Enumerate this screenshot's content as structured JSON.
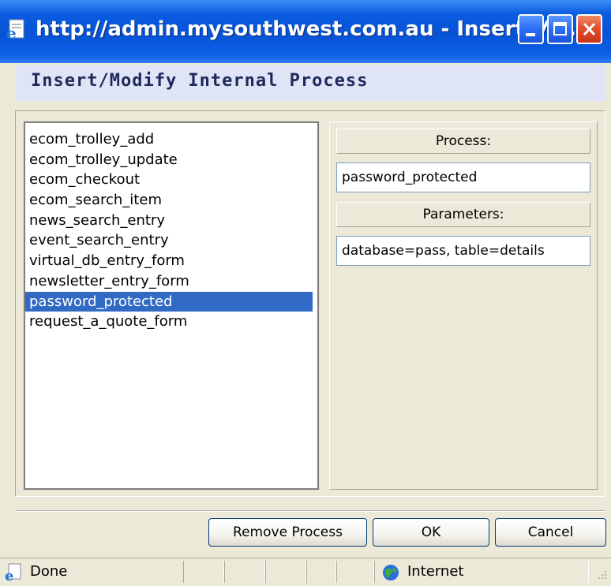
{
  "window": {
    "title": "http://admin.mysouthwest.com.au - Insert/M...",
    "icons": {
      "app": "ie-page-icon",
      "minimize": "minimize-icon",
      "maximize": "maximize-icon",
      "close": "close-icon"
    }
  },
  "dialog": {
    "heading": "Insert/Modify Internal Process"
  },
  "process_list": {
    "items": [
      "ecom_trolley_add",
      "ecom_trolley_update",
      "ecom_checkout",
      "ecom_search_item",
      "news_search_entry",
      "event_search_entry",
      "virtual_db_entry_form",
      "newsletter_entry_form",
      "password_protected",
      "request_a_quote_form"
    ],
    "selected": "password_protected"
  },
  "details": {
    "process_label": "Process:",
    "process_value": "password_protected",
    "parameters_label": "Parameters:",
    "parameters_value": "database=pass, table=details"
  },
  "buttons": {
    "remove": "Remove Process",
    "ok": "OK",
    "cancel": "Cancel"
  },
  "statusbar": {
    "status": "Done",
    "zone": "Internet",
    "icons": {
      "page": "ie-icon",
      "zone": "globe-icon"
    }
  },
  "colors": {
    "titlebar": "#0753d6",
    "selection": "#316ac5",
    "header_band": "#dfe4f7",
    "dialog_bg": "#ece9d8"
  }
}
